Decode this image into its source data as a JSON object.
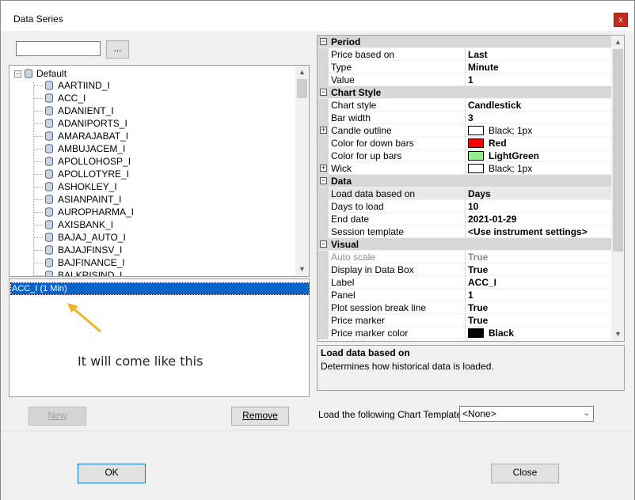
{
  "window": {
    "title": "Data Series",
    "close_glyph": "x"
  },
  "instrument_search": {
    "value": "",
    "browse_label": "..."
  },
  "tree": {
    "root_label": "Default",
    "items": [
      "AARTIIND_I",
      "ACC_I",
      "ADANIENT_I",
      "ADANIPORTS_I",
      "AMARAJABAT_I",
      "AMBUJACEM_I",
      "APOLLOHOSP_I",
      "APOLLOTYRE_I",
      "ASHOKLEY_I",
      "ASIANPAINT_I",
      "AUROPHARMA_I",
      "AXISBANK_I",
      "BAJAJ_AUTO_I",
      "BAJAJFINSV_I",
      "BAJFINANCE_I",
      "BALKRISIND_I"
    ]
  },
  "selected_series": {
    "items": [
      "ACC_I (1 Min)"
    ]
  },
  "annotation": {
    "text": "It will come like this",
    "arrow_color": "#f0b429"
  },
  "buttons": {
    "new_label": "New",
    "remove_label": "Remove",
    "ok_label": "OK",
    "close_label": "Close"
  },
  "properties": {
    "period": {
      "title": "Period",
      "price_based_on": {
        "name": "Price based on",
        "value": "Last"
      },
      "type": {
        "name": "Type",
        "value": "Minute"
      },
      "value": {
        "name": "Value",
        "value": "1"
      }
    },
    "chart_style": {
      "title": "Chart Style",
      "chart_style": {
        "name": "Chart style",
        "value": "Candlestick"
      },
      "bar_width": {
        "name": "Bar width",
        "value": "3"
      },
      "candle_outline": {
        "name": "Candle outline",
        "value": "Black; 1px"
      },
      "down_color": {
        "name": "Color for down bars",
        "value": "Red",
        "color": "#ff0000"
      },
      "up_color": {
        "name": "Color for up bars",
        "value": "LightGreen",
        "color": "#90ee90"
      },
      "wick": {
        "name": "Wick",
        "value": "Black; 1px"
      }
    },
    "data": {
      "title": "Data",
      "load_based_on": {
        "name": "Load data based on",
        "value": "Days"
      },
      "days_to_load": {
        "name": "Days to load",
        "value": "10"
      },
      "end_date": {
        "name": "End date",
        "value": "2021-01-29"
      },
      "session_template": {
        "name": "Session template",
        "value": "<Use instrument settings>"
      }
    },
    "visual": {
      "title": "Visual",
      "auto_scale": {
        "name": "Auto scale",
        "value": "True"
      },
      "display_in_data_box": {
        "name": "Display in Data Box",
        "value": "True"
      },
      "label": {
        "name": "Label",
        "value": "ACC_I"
      },
      "panel": {
        "name": "Panel",
        "value": "1"
      },
      "plot_session_break": {
        "name": "Plot session break line",
        "value": "True"
      },
      "price_marker": {
        "name": "Price marker",
        "value": "True"
      },
      "price_marker_color": {
        "name": "Price marker color",
        "value": "Black",
        "color": "#000000"
      }
    }
  },
  "description": {
    "title": "Load data based on",
    "text": "Determines how historical data is loaded."
  },
  "chart_template": {
    "label": "Load the following Chart Template:",
    "selected": "<None>"
  }
}
